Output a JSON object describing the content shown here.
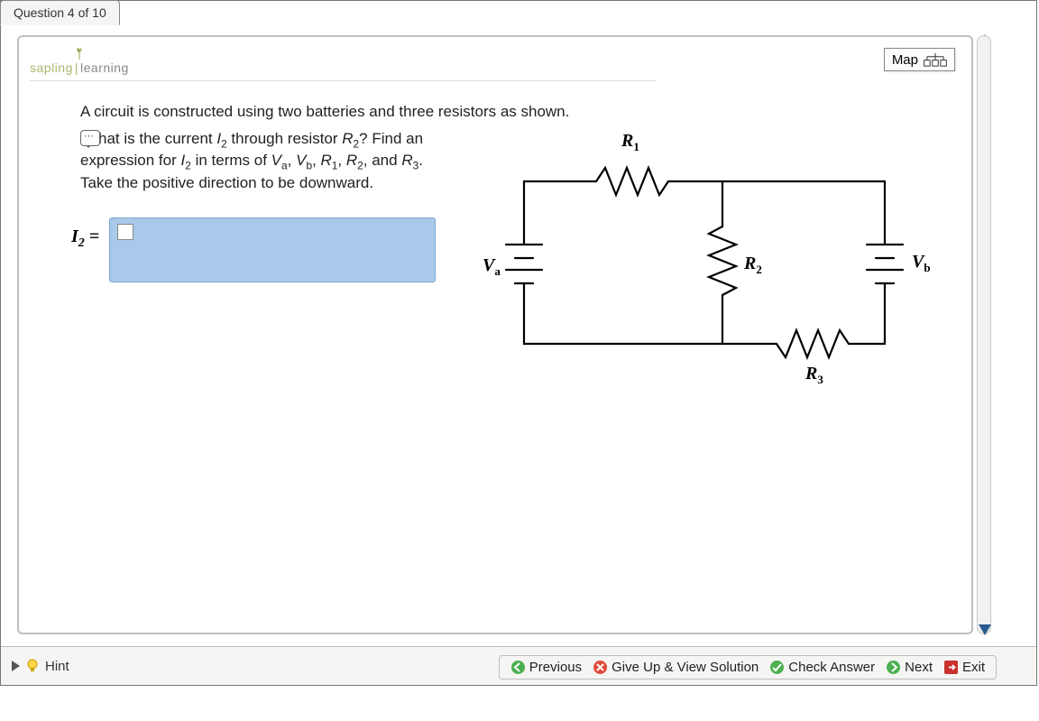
{
  "tab_label": "Question 4 of 10",
  "brand": {
    "left": "sapling",
    "right": "learning"
  },
  "map_button": "Map",
  "intro_text": "A circuit is constructed using two batteries and three resistors as shown.",
  "prompt_html": "hat is the current I₂ through resistor R₂? Find an expression for I₂ in terms of Vₐ, Vᵦ, R₁, R₂, and R₃. Take the positive direction to be downward.",
  "answer_label": "I₂ =",
  "circuit_labels": {
    "R1": "R₁",
    "R2": "R₂",
    "R3": "R₃",
    "Va": "Vₐ",
    "Vb": "Vᵦ"
  },
  "footer": {
    "hint": "Hint",
    "previous": "Previous",
    "giveup": "Give Up & View Solution",
    "check": "Check Answer",
    "next": "Next",
    "exit": "Exit"
  }
}
